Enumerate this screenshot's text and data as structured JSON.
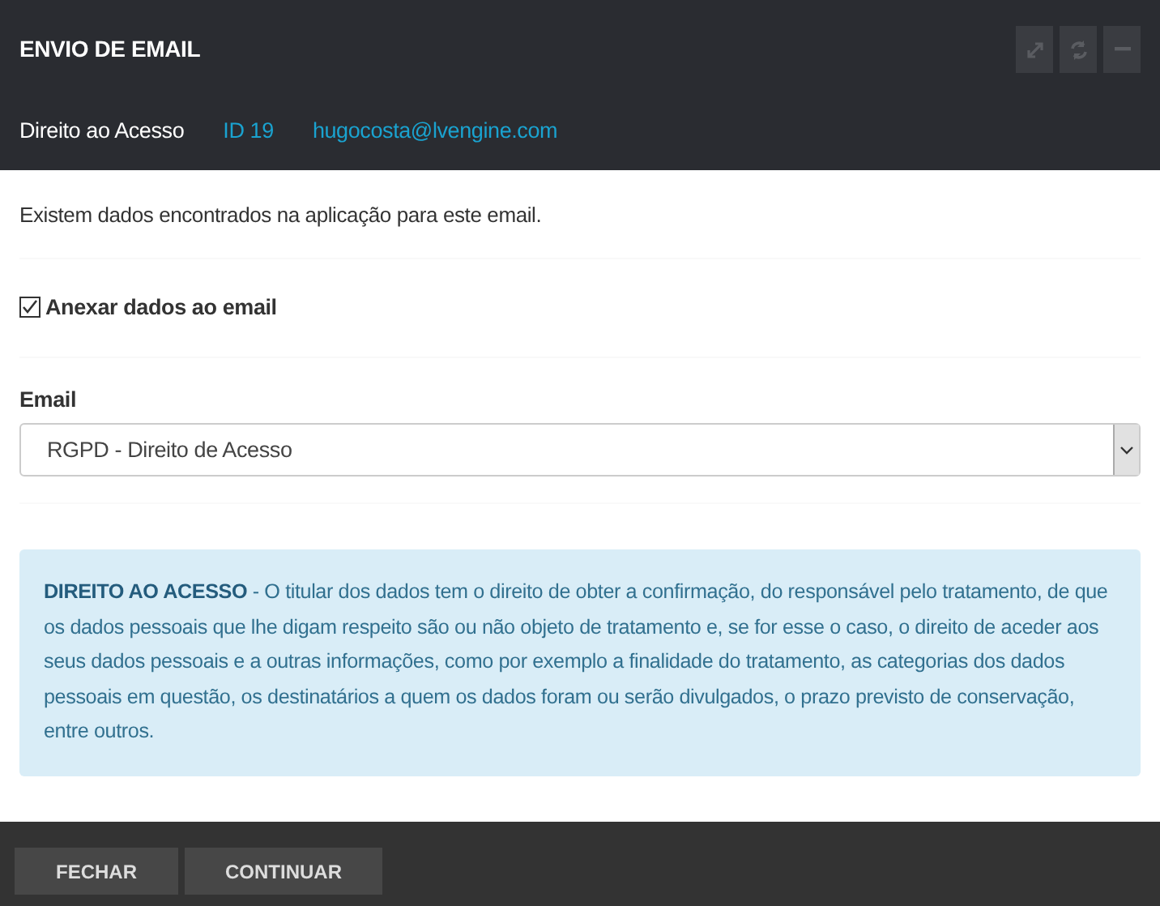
{
  "window": {
    "title": "ENVIO DE EMAIL"
  },
  "header_info": {
    "request_type": "Direito ao Acesso",
    "id": "ID 19",
    "email": "hugocosta@lvengine.com"
  },
  "message": "Existem dados encontrados na aplicação para este email.",
  "attach_checkbox": {
    "label": "Anexar dados ao email",
    "checked": true
  },
  "email_select": {
    "label": "Email",
    "value": "RGPD - Direito de Acesso"
  },
  "info_alert": "**DIREITO AO ACESSO** - O titular dos dados tem o direito de obter a confirmação, do responsável pelo tratamento, de que os dados pessoais que lhe digam respeito são ou não objeto de tratamento e, se for esse o caso, o direito de aceder aos seus dados pessoais e a outras informações, como por exemplo a finalidade do tratamento, as categorias dos dados pessoais em questão, os destinatários a quem os dados foram ou serão divulgados, o prazo previsto de conservação, entre outros.",
  "buttons": [
    "FECHAR",
    "CONTINUAR"
  ]
}
